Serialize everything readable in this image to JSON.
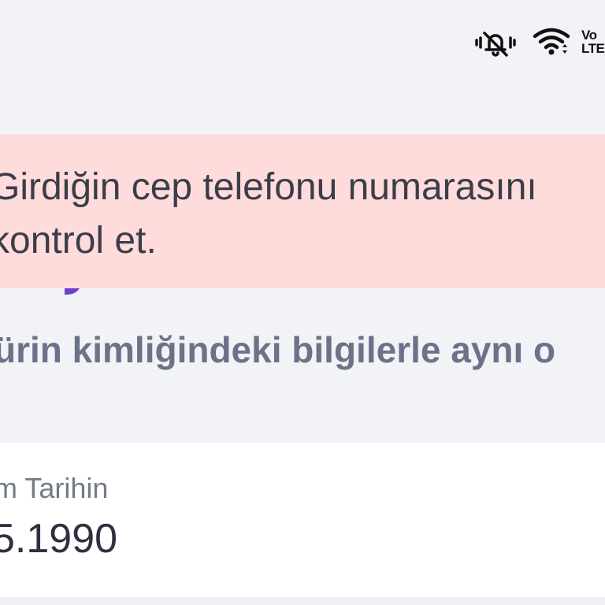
{
  "status_bar": {
    "icons": [
      "bell-off-icon",
      "wifi-icon",
      "volte-icon"
    ],
    "volte_line1": "Vo",
    "volte_line2": "LTE"
  },
  "error_banner": {
    "message": "Girdiğin cep telefonu numarasını\nkontrol et.",
    "color": "#ffdcdc",
    "text_color": "#3b3d4a"
  },
  "form": {
    "subtitle": "ürin kimliğindeki bilgilerle aynı o",
    "birth_date": {
      "label": "m Tarihin",
      "value": "5.1990"
    }
  },
  "colors": {
    "background": "#f2f3f6",
    "accent": "#6f3fcf",
    "card": "#ffffff",
    "muted_text": "#6c7288"
  }
}
